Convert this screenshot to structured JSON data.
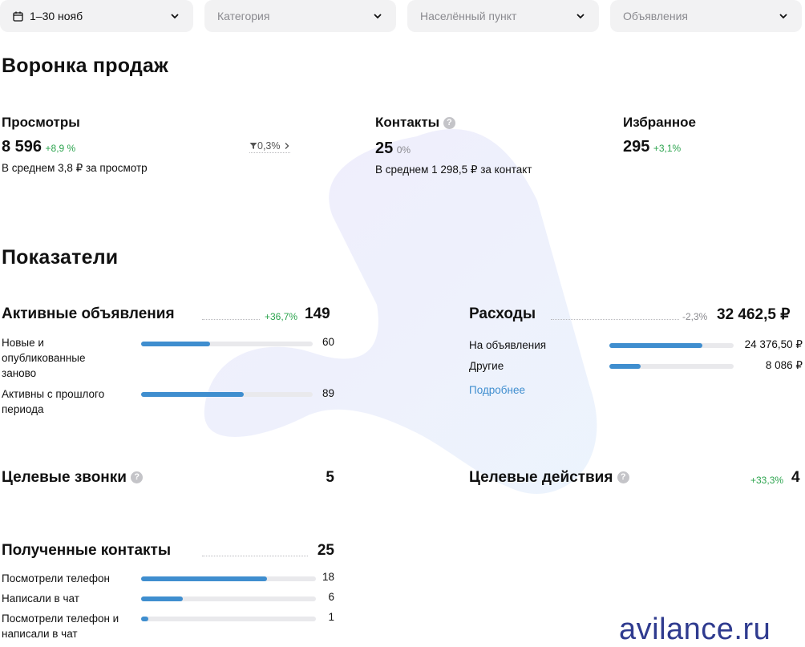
{
  "filters": {
    "date": "1–30 нояб",
    "category": "Категория",
    "locality": "Населённый пункт",
    "ads": "Объявления"
  },
  "funnel": {
    "title": "Воронка продаж",
    "views": {
      "label": "Просмотры",
      "value": "8 596",
      "change": "+8,9 %",
      "conversion": "0,3%",
      "avg": "В среднем 3,8 ₽ за просмотр"
    },
    "contacts": {
      "label": "Контакты",
      "value": "25",
      "change": "0%",
      "avg": "В среднем 1 298,5 ₽ за контакт"
    },
    "favorites": {
      "label": "Избранное",
      "value": "295",
      "change": "+3,1%"
    }
  },
  "metrics": {
    "title": "Показатели",
    "active_ads": {
      "label": "Активные объявления",
      "change": "+36,7%",
      "total": "149",
      "rows": [
        {
          "label": "Новые и опубликованные заново",
          "value": "60",
          "progress": 0.4
        },
        {
          "label": "Активны с прошлого периода",
          "value": "89",
          "progress": 0.6
        }
      ]
    },
    "expenses": {
      "label": "Расходы",
      "change": "-2,3%",
      "total": "32 462,5 ₽",
      "rows": [
        {
          "label": "На объявления",
          "value": "24 376,50 ₽",
          "progress": 0.75
        },
        {
          "label": "Другие",
          "value": "8 086 ₽",
          "progress": 0.25
        }
      ],
      "more_link": "Подробнее"
    },
    "target_calls": {
      "label": "Целевые звонки",
      "value": "5"
    },
    "target_actions": {
      "label": "Целевые действия",
      "change": "+33,3%",
      "value": "4"
    },
    "received_contacts": {
      "label": "Полученные контакты",
      "total": "25",
      "rows": [
        {
          "label": "Посмотрели телефон",
          "value": "18",
          "progress": 0.72
        },
        {
          "label": "Написали в чат",
          "value": "6",
          "progress": 0.24
        },
        {
          "label": "Посмотрели телефон и написали в чат",
          "value": "1",
          "progress": 0.04
        }
      ]
    }
  },
  "watermark": "avilance.ru",
  "colors": {
    "bar": "#3f8ecf",
    "positive": "#2ca44e",
    "link": "#3f8ecf",
    "brand": "#2f3b8f"
  }
}
